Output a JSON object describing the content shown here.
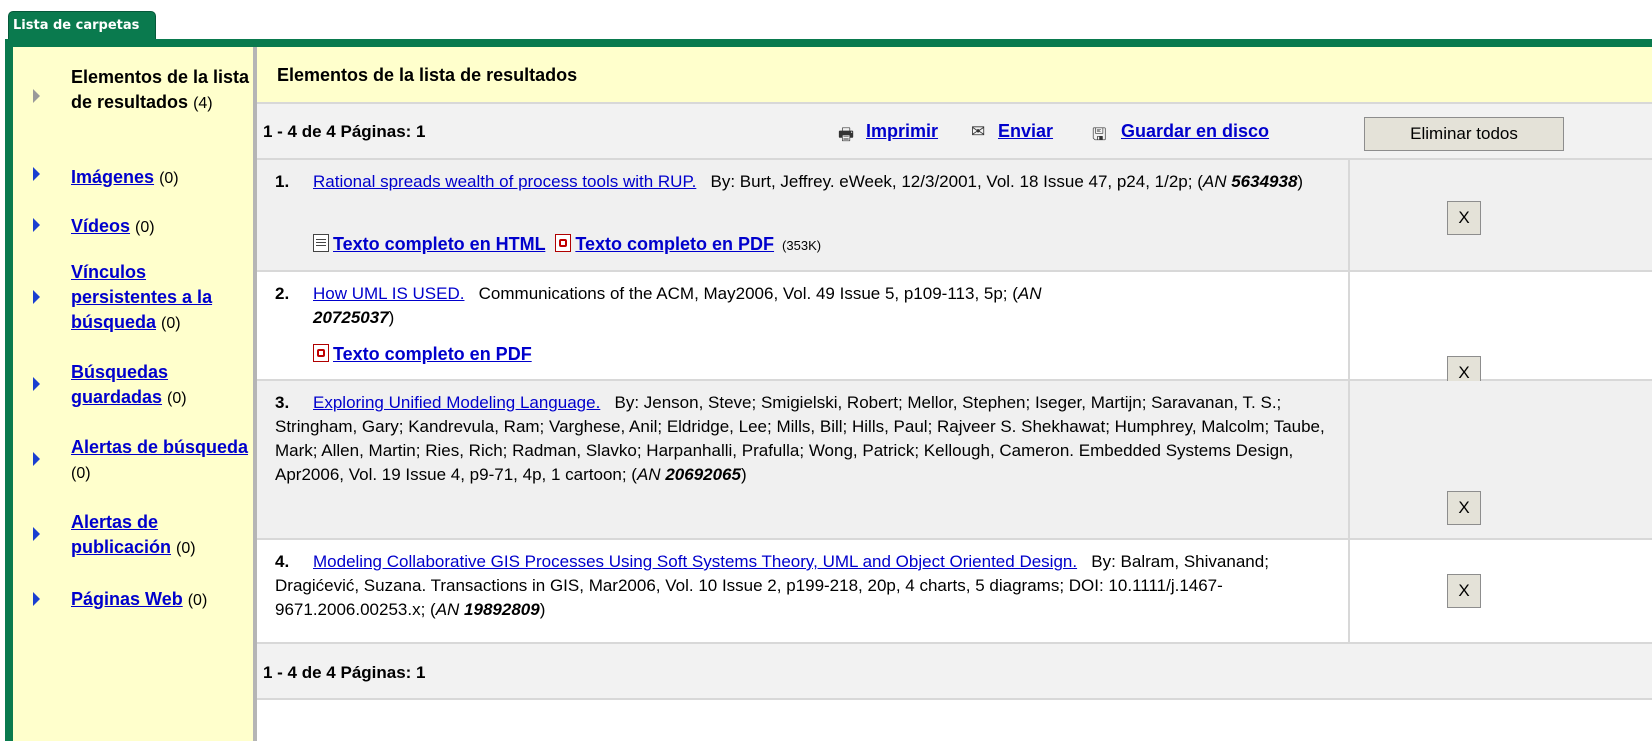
{
  "tab": {
    "label": "Lista de carpetas"
  },
  "sidebar": {
    "items": [
      {
        "label": "Elementos de la lista de resultados",
        "count": "(4)",
        "link": false
      },
      {
        "label": "Imágenes",
        "count": "(0)",
        "link": true
      },
      {
        "label": "Vídeos",
        "count": "(0)",
        "link": true
      },
      {
        "label": "Vínculos persistentes a la búsqueda",
        "count": "(0)",
        "link": true
      },
      {
        "label": "Búsquedas guardadas",
        "count": "(0)",
        "link": true
      },
      {
        "label": "Alertas de búsqueda",
        "count": "(0)",
        "link": true
      },
      {
        "label": "Alertas de publicación",
        "count": "(0)",
        "link": true
      },
      {
        "label": "Páginas Web",
        "count": "(0)",
        "link": true
      }
    ]
  },
  "header": {
    "title": "Elementos de la lista de resultados"
  },
  "toolbar": {
    "page_info": "1 - 4 de 4  Páginas: 1",
    "print_label": "Imprimir",
    "send_label": "Enviar",
    "save_label": "Guardar en disco",
    "remove_all_label": "Eliminar todos"
  },
  "results": [
    {
      "num": "1.",
      "title": "Rational spreads wealth of process tools with RUP.",
      "meta": "By: Burt, Jeffrey. eWeek, 12/3/2001, Vol. 18 Issue 47, p24, 1/2p; (",
      "an_label": "AN",
      "an_value": "5634938",
      "tail": ")",
      "html_link": "Texto completo en HTML",
      "pdf_link": "Texto completo en PDF",
      "pdf_size": "(353K)",
      "remove_label": "X"
    },
    {
      "num": "2.",
      "title": "How UML IS USED.",
      "meta": "Communications of the ACM, May2006, Vol. 49 Issue 5, p109-113, 5p; (",
      "an_label": "AN",
      "an_value": "20725037",
      "tail": ")",
      "pdf_link": "Texto completo en PDF",
      "remove_label": "X"
    },
    {
      "num": "3.",
      "title": "Exploring Unified Modeling Language.",
      "meta": "By: Jenson, Steve; Smigielski, Robert; Mellor, Stephen; Iseger, Martijn; Saravanan, T. S.; Stringham, Gary; Kandrevula, Ram; Varghese, Anil; Eldridge, Lee; Mills, Bill; Hills, Paul; Rajveer S. Shekhawat; Humphrey, Malcolm; Taube, Mark; Allen, Martin; Ries, Rich; Radman, Slavko; Harpanhalli, Prafulla; Wong, Patrick; Kellough, Cameron. Embedded Systems Design, Apr2006, Vol. 19 Issue 4, p9-71, 4p, 1 cartoon; (",
      "an_label": "AN",
      "an_value": "20692065",
      "tail": ")",
      "remove_label": "X"
    },
    {
      "num": "4.",
      "title": "Modeling Collaborative GIS Processes Using Soft Systems Theory, UML and Object Oriented Design.",
      "meta": "By: Balram, Shivanand; Dragićević, Suzana. Transactions in GIS, Mar2006, Vol. 10 Issue 2, p199-218, 20p, 4 charts, 5 diagrams; DOI: 10.1111/j.1467-9671.2006.00253.x; (",
      "an_label": "AN",
      "an_value": "19892809",
      "tail": ")",
      "remove_label": "X"
    }
  ],
  "footer": {
    "page_info": "1 - 4 de 4  Páginas: 1"
  },
  "colors": {
    "tab_green": "#0a7a4e",
    "sidebar_yellow": "#ffffcc",
    "link_blue": "#0000cc"
  }
}
